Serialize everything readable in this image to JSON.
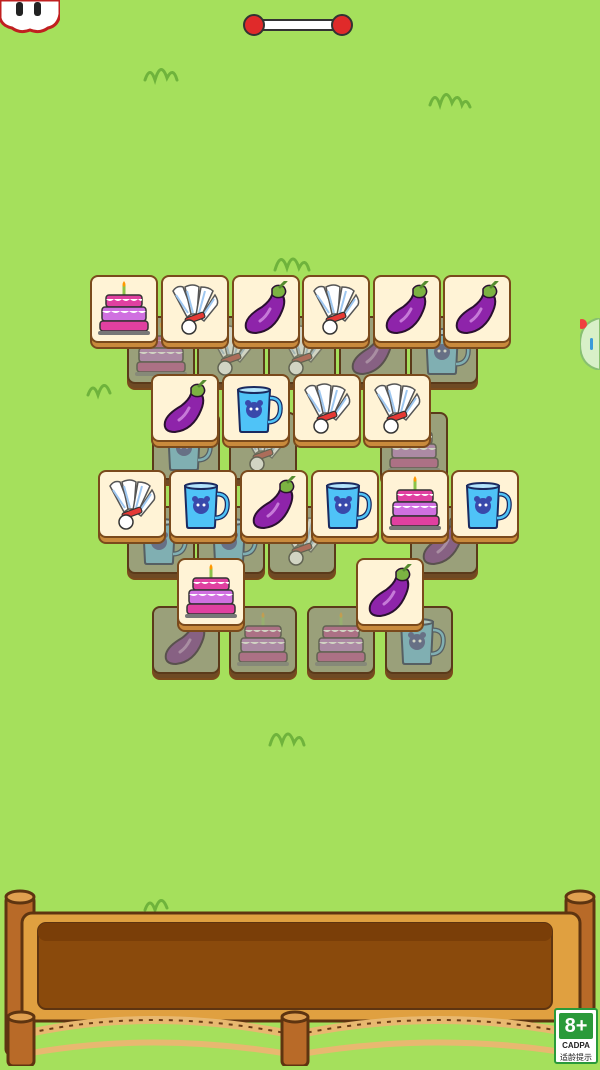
{
  "hud": {
    "pause_icon": "paws-icon",
    "progress": 0.0
  },
  "board": {
    "layers": [
      {
        "name": "bottom",
        "tiles": [
          {
            "icon": "eggplant-icon"
          },
          {
            "icon": "cake-icon"
          },
          {
            "icon": "cake-icon"
          },
          {
            "icon": "mug-icon"
          }
        ]
      },
      {
        "name": "mid",
        "tiles": [
          {
            "icon": "cake-icon"
          },
          {
            "icon": "shuttlecock-icon"
          },
          {
            "icon": "shuttlecock-icon"
          },
          {
            "icon": "eggplant-icon"
          },
          {
            "icon": "mug-icon"
          },
          {
            "icon": "mug-icon"
          },
          {
            "icon": "shuttlecock-icon"
          },
          {
            "icon": "cake-icon"
          },
          {
            "icon": "mug-icon"
          },
          {
            "icon": "mug-icon"
          },
          {
            "icon": "shuttlecock-icon"
          },
          {
            "icon": "eggplant-icon"
          }
        ]
      },
      {
        "name": "top",
        "tiles": [
          {
            "icon": "cake-icon"
          },
          {
            "icon": "shuttlecock-icon"
          },
          {
            "icon": "eggplant-icon"
          },
          {
            "icon": "shuttlecock-icon"
          },
          {
            "icon": "eggplant-icon"
          },
          {
            "icon": "eggplant-icon"
          },
          {
            "icon": "eggplant-icon"
          },
          {
            "icon": "mug-icon"
          },
          {
            "icon": "shuttlecock-icon"
          },
          {
            "icon": "shuttlecock-icon"
          },
          {
            "icon": "shuttlecock-icon"
          },
          {
            "icon": "mug-icon"
          },
          {
            "icon": "eggplant-icon"
          },
          {
            "icon": "mug-icon"
          },
          {
            "icon": "cake-icon"
          },
          {
            "icon": "mug-icon"
          },
          {
            "icon": "cake-icon"
          },
          {
            "icon": "eggplant-icon"
          }
        ]
      }
    ]
  },
  "tray": {
    "slots_filled": 0
  },
  "age_rating": {
    "label": "8+",
    "org": "CADPA",
    "note": "适龄提示"
  },
  "colors": {
    "grass": "#a5e05c",
    "tile_face": "#fff3d6",
    "tile_edge": "#c98a3c",
    "wood": "#e0a040",
    "tray_inner": "#8a4a0c",
    "progress_red": "#e02a2a"
  }
}
